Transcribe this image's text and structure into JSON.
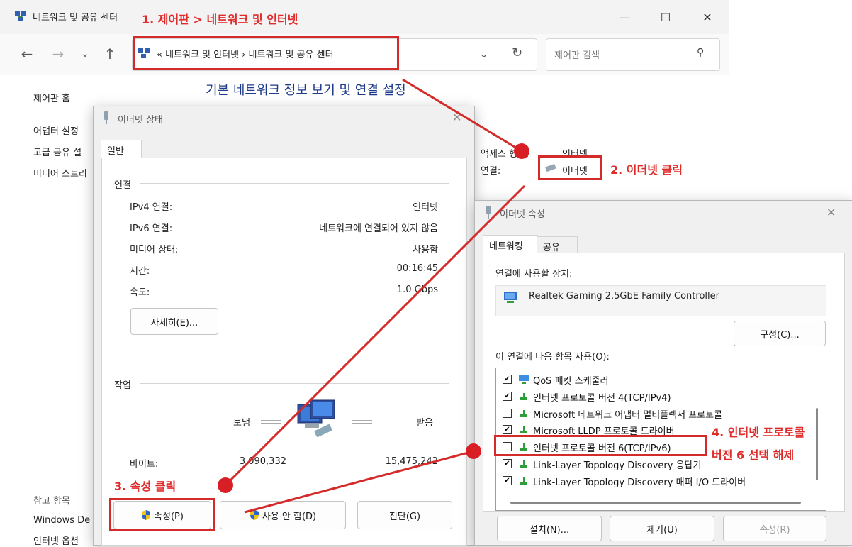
{
  "main_window": {
    "title": "네트워크 및 공유 센터",
    "address": "«  네트워크 및 인터넷  ›  네트워크 및 공유 센터",
    "search_placeholder": "제어판 검색",
    "heading": "기본 네트워크 정보 보기 및 연결 설정",
    "sidebar": [
      "제어판 홈",
      "어댑터 설정",
      "고급 공유 설",
      "미디어 스트리"
    ],
    "see_also": [
      "참고 항목",
      "Windows De",
      "인터넷 옵션"
    ],
    "access_type_label": "액세스 형식:",
    "access_type_value": "인터넷",
    "connection_label": "연결:",
    "connection_value": "이더넷"
  },
  "status_dialog": {
    "title": "이더넷 상태",
    "tab": "일반",
    "connection_section": "연결",
    "rows": [
      {
        "label": "IPv4 연결:",
        "value": "인터넷"
      },
      {
        "label": "IPv6 연결:",
        "value": "네트워크에 연결되어 있지 않음"
      },
      {
        "label": "미디어 상태:",
        "value": "사용함"
      },
      {
        "label": "시간:",
        "value": "00:16:45"
      },
      {
        "label": "속도:",
        "value": "1.0 Gbps"
      }
    ],
    "details_button": "자세히(E)...",
    "activity_section": "작업",
    "sent_label": "보냄",
    "received_label": "받음",
    "bytes_label": "바이트:",
    "bytes_sent": "3,090,332",
    "bytes_received": "15,475,242",
    "properties_button": "속성(P)",
    "disable_button": "사용 안 함(D)",
    "diagnose_button": "진단(G)"
  },
  "props_dialog": {
    "title": "이더넷 속성",
    "tabs": [
      "네트워킹",
      "공유"
    ],
    "connect_using_label": "연결에 사용할 장치:",
    "adapter": "Realtek Gaming 2.5GbE Family Controller",
    "configure_button": "구성(C)...",
    "items_label": "이 연결에 다음 항목 사용(O):",
    "items": [
      {
        "checked": true,
        "label": "QoS 패킷 스케줄러"
      },
      {
        "checked": true,
        "label": "인터넷 프로토콜 버전 4(TCP/IPv4)"
      },
      {
        "checked": false,
        "label": "Microsoft 네트워크 어댑터 멀티플렉서 프로토콜"
      },
      {
        "checked": true,
        "label": "Microsoft LLDP 프로토콜 드라이버"
      },
      {
        "checked": false,
        "label": "인터넷 프로토콜 버전 6(TCP/IPv6)"
      },
      {
        "checked": true,
        "label": "Link-Layer Topology Discovery 응답기"
      },
      {
        "checked": true,
        "label": "Link-Layer Topology Discovery 매퍼 I/O 드라이버"
      }
    ],
    "install_button": "설치(N)...",
    "uninstall_button": "제거(U)",
    "properties_button": "속성(R)"
  },
  "annotations": {
    "step1": "1. 제어판 > 네트워크 및 인터넷",
    "step2": "2. 이더넷 클릭",
    "step3": "3. 속성 클릭",
    "step4_line1": "4. 인터넷 프로토콜",
    "step4_line2": "버전 6 선택 해제",
    "color": "#e02b2b"
  }
}
